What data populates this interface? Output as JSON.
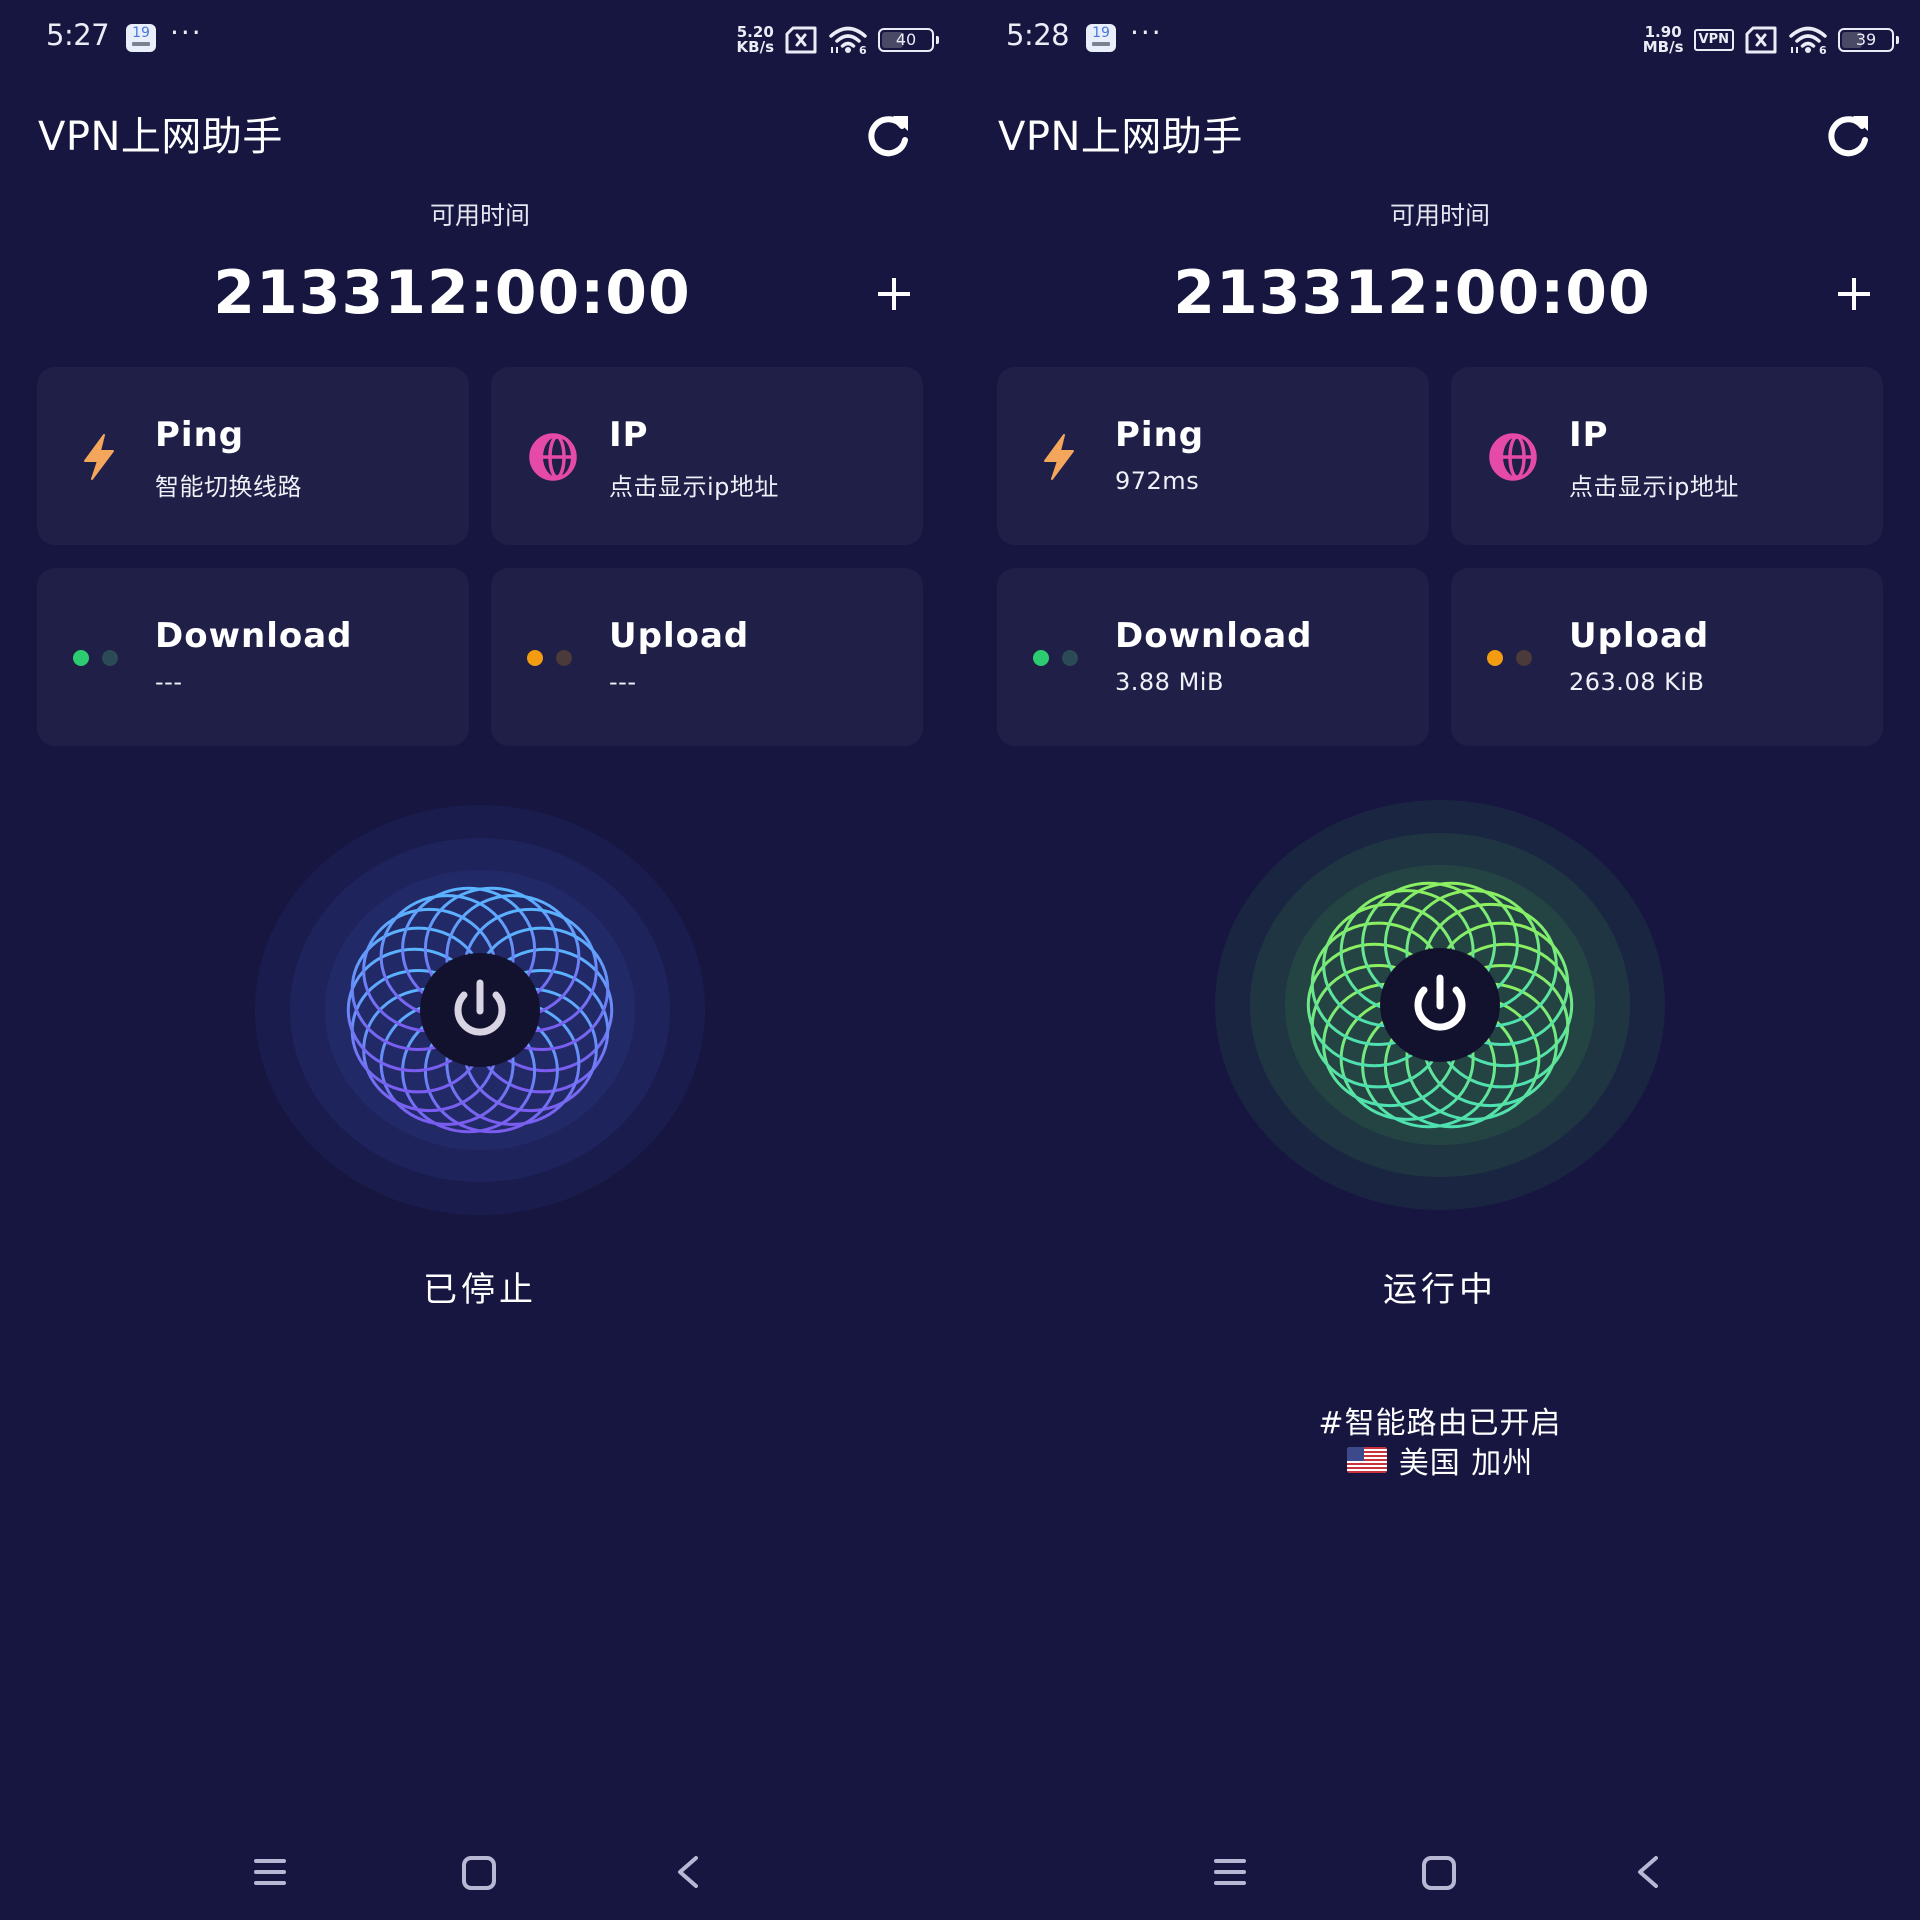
{
  "screens": [
    {
      "state": "stopped",
      "status_bar": {
        "time": "5:27",
        "calendar_day": "19",
        "more": "···",
        "net_speed_value": "5.20",
        "net_speed_unit": "KB/s",
        "vpn_badge": "",
        "battery_level": 40,
        "battery_text": "40"
      },
      "header": {
        "title": "VPN上网助手",
        "refresh_icon": "refresh-icon"
      },
      "timer": {
        "label": "可用时间",
        "value": "213312:00:00",
        "add_icon": "plus-icon"
      },
      "cards": {
        "ping": {
          "title": "Ping",
          "value": "智能切换线路",
          "icon": "lightning-icon"
        },
        "ip": {
          "title": "IP",
          "value": "点击显示ip地址",
          "icon": "globe-icon"
        },
        "download": {
          "title": "Download",
          "value": "---",
          "icon": "dots-indicator-icon"
        },
        "upload": {
          "title": "Upload",
          "value": "---",
          "icon": "dots-indicator-icon"
        }
      },
      "power": {
        "status": "已停止",
        "icon": "power-icon"
      },
      "route": {
        "text": "",
        "location": ""
      }
    },
    {
      "state": "running",
      "status_bar": {
        "time": "5:28",
        "calendar_day": "19",
        "more": "···",
        "net_speed_value": "1.90",
        "net_speed_unit": "MB/s",
        "vpn_badge": "VPN",
        "battery_level": 39,
        "battery_text": "39"
      },
      "header": {
        "title": "VPN上网助手",
        "refresh_icon": "refresh-icon"
      },
      "timer": {
        "label": "可用时间",
        "value": "213312:00:00",
        "add_icon": "plus-icon"
      },
      "cards": {
        "ping": {
          "title": "Ping",
          "value": "972ms",
          "icon": "lightning-icon"
        },
        "ip": {
          "title": "IP",
          "value": "点击显示ip地址",
          "icon": "globe-icon"
        },
        "download": {
          "title": "Download",
          "value": "3.88 MiB",
          "icon": "dots-indicator-icon"
        },
        "upload": {
          "title": "Upload",
          "value": "263.08 KiB",
          "icon": "dots-indicator-icon"
        }
      },
      "power": {
        "status": "运行中",
        "icon": "power-icon"
      },
      "route": {
        "text": "#智能路由已开启",
        "location": "美国 加州",
        "flag": "us-flag"
      }
    }
  ],
  "colors": {
    "background": "#161640",
    "card": "#1f1f47",
    "ping_icon": "#f4a65c",
    "ip_icon": "#e64aa8",
    "download_dot": "#2ecc71",
    "download_dot_dim": "#2b4a55",
    "upload_dot": "#f39c12",
    "upload_dot_dim": "#4a3a3a",
    "orb_stopped": "#5a8cff",
    "orb_running": "#6ef07a"
  },
  "nav": {
    "menu_icon": "menu-icon",
    "home_icon": "home-icon",
    "back_icon": "back-icon"
  }
}
